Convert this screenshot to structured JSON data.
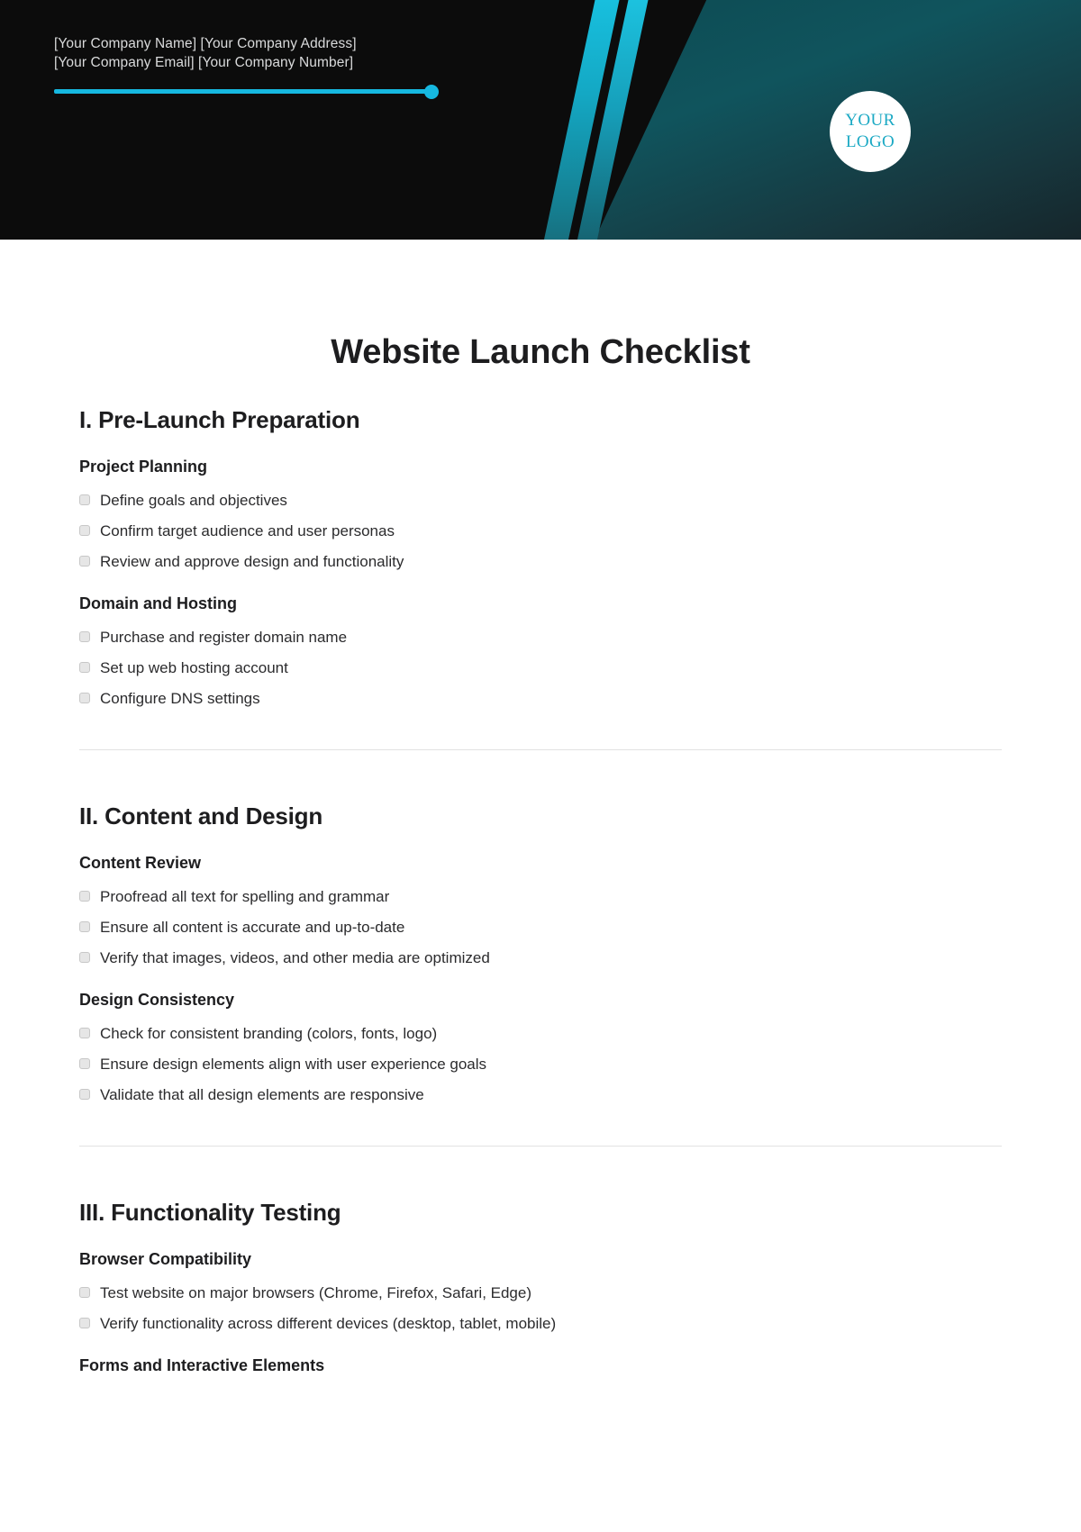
{
  "banner": {
    "company_name_address": "[Your Company Name] [Your Company Address]",
    "company_email_number": "[Your Company Email] [Your Company Number]",
    "logo_line1": "YOUR",
    "logo_line2": "LOGO",
    "accent_color": "#16b8e0",
    "background_color": "#0c0c0c",
    "wedge_color": "#10545d",
    "logo_text_color": "#1ba9c4"
  },
  "document": {
    "title": "Website Launch Checklist",
    "sections": [
      {
        "heading": "I. Pre-Launch Preparation",
        "groups": [
          {
            "heading": "Project Planning",
            "items": [
              "Define goals and objectives",
              "Confirm target audience and user personas",
              "Review and approve design and functionality"
            ]
          },
          {
            "heading": "Domain and Hosting",
            "items": [
              "Purchase and register domain name",
              "Set up web hosting account",
              "Configure DNS settings"
            ]
          }
        ]
      },
      {
        "heading": "II. Content and Design",
        "groups": [
          {
            "heading": "Content Review",
            "items": [
              "Proofread all text for spelling and grammar",
              "Ensure all content is accurate and up-to-date",
              "Verify that images, videos, and other media are optimized"
            ]
          },
          {
            "heading": "Design Consistency",
            "items": [
              "Check for consistent branding (colors, fonts, logo)",
              "Ensure design elements align with user experience goals",
              "Validate that all design elements are responsive"
            ]
          }
        ]
      },
      {
        "heading": "III. Functionality Testing",
        "groups": [
          {
            "heading": "Browser Compatibility",
            "items": [
              "Test website on major browsers (Chrome, Firefox, Safari, Edge)",
              "Verify functionality across different devices (desktop, tablet, mobile)"
            ]
          },
          {
            "heading": "Forms and Interactive Elements",
            "items": []
          }
        ]
      }
    ]
  }
}
